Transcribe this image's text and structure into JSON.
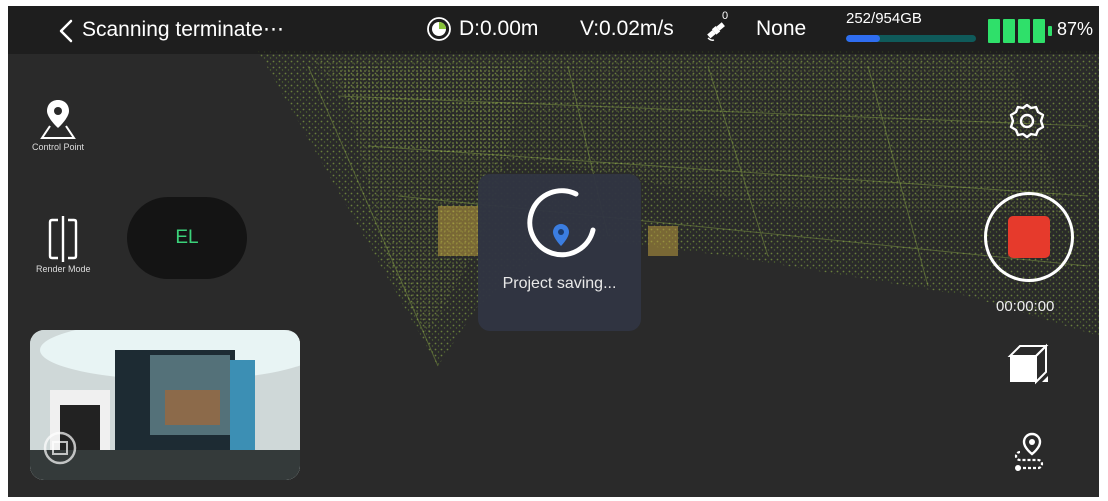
{
  "topbar": {
    "title": "Scanning terminate⋯",
    "distance": "D:0.00m",
    "velocity": "V:0.02m/s",
    "satellite_count": "0",
    "rtk_status": "None",
    "storage_text": "252/954GB",
    "storage_used_fraction": 0.264,
    "battery_percent": "87%",
    "battery_level": 0.87
  },
  "left_tools": {
    "control_point_label": "Control Point",
    "render_mode_label": "Render Mode",
    "el_label": "EL"
  },
  "overlay": {
    "saving_text": "Project saving..."
  },
  "right_tools": {
    "timer": "00:00:00"
  },
  "colors": {
    "record": "#e63a2c",
    "el_text": "#3bd27a",
    "storage_fill": "#2f6df0",
    "battery": "#2fe06a",
    "point_cloud": "#8ab840"
  }
}
